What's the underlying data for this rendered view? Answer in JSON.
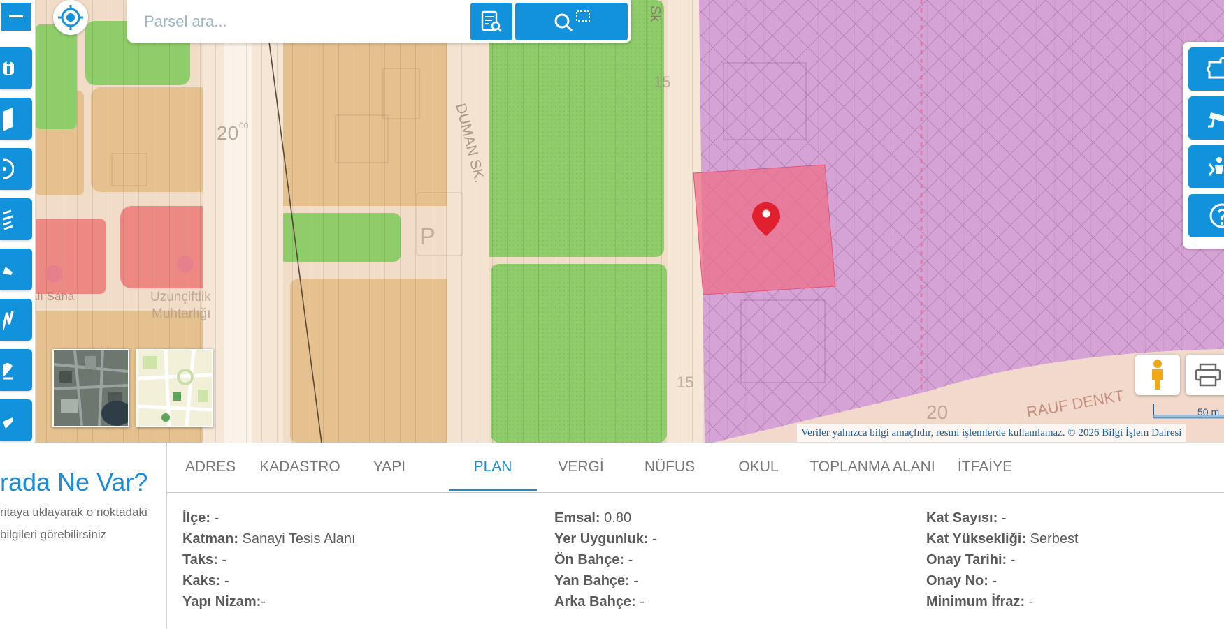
{
  "search": {
    "placeholder": "Parsel ara..."
  },
  "map": {
    "labels": {
      "road_20_left": "20",
      "road_20_sup": "00",
      "road_15_top": "15",
      "road_15_bottom": "15",
      "road_20_right": "20",
      "sk_top": "Sk",
      "duman_sk": "DUMAN SK.",
      "rauf_denk": "RAUF DENKT",
      "park_sign": "P",
      "saha": "alı Saha",
      "muhtarlik_1": "Uzunçiftlik",
      "muhtarlik_2": "Muhtarlığı"
    },
    "attribution": "Veriler yalnızca bilgi amaçlıdır, resmi işlemlerde kullanılamaz. © 2026 Bilgi İşlem Dairesi",
    "scale_label": "50 m"
  },
  "left_info": {
    "title": "rada Ne Var?",
    "line1": "ritaya tıklayarak o noktadaki",
    "line2": "bilgileri görebilirsiniz"
  },
  "tabs": [
    {
      "label": "ADRES"
    },
    {
      "label": "KADASTRO"
    },
    {
      "label": "YAPI"
    },
    {
      "label": "PLAN",
      "active": true
    },
    {
      "label": "VERGİ"
    },
    {
      "label": "NÜFUS"
    },
    {
      "label": "OKUL"
    },
    {
      "label": "TOPLANMA ALANI"
    },
    {
      "label": "İTFAİYE"
    }
  ],
  "plan": {
    "col1": [
      {
        "label": "İlçe:",
        "value": " -"
      },
      {
        "label": "Katman:",
        "value": " Sanayi Tesis Alanı"
      },
      {
        "label": "Taks:",
        "value": " -"
      },
      {
        "label": "Kaks:",
        "value": " -"
      },
      {
        "label": "Yapı Nizam:",
        "value": "-"
      }
    ],
    "col2": [
      {
        "label": "Emsal:",
        "value": " 0.80"
      },
      {
        "label": "Yer Uygunluk:",
        "value": " -"
      },
      {
        "label": "Ön Bahçe:",
        "value": " -"
      },
      {
        "label": "Yan Bahçe:",
        "value": " -"
      },
      {
        "label": "Arka Bahçe:",
        "value": " -"
      }
    ],
    "col3": [
      {
        "label": "Kat Sayısı:",
        "value": " -"
      },
      {
        "label": "Kat Yüksekliği:",
        "value": " Serbest"
      },
      {
        "label": "Onay Tarihi:",
        "value": " -"
      },
      {
        "label": "Onay No:",
        "value": " -"
      },
      {
        "label": "Minimum İfraz:",
        "value": " -"
      }
    ]
  },
  "colors": {
    "accent": "#1392dc",
    "tab_active": "#1a8cd8",
    "residential": "#e8c28f",
    "green": "#8fcc6a",
    "industrial": "#d8a6d8",
    "commercial": "#ef8b86",
    "marker": "#e0202e"
  }
}
